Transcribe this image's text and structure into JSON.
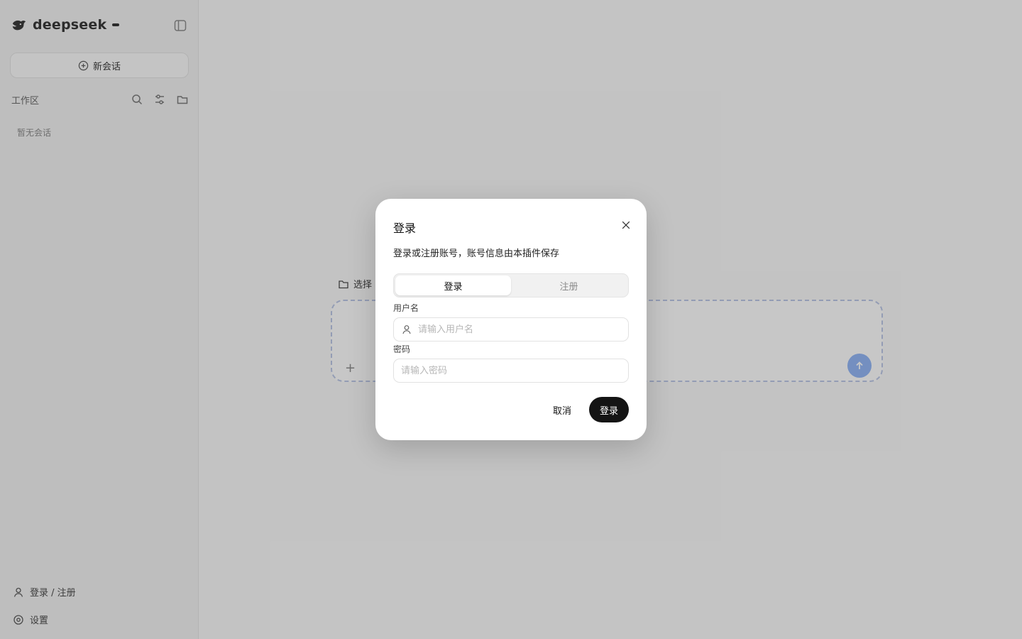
{
  "sidebar": {
    "brand_name": "deepseek",
    "brand_badge": "",
    "new_chat_label": "新会话",
    "workspace_label": "工作区",
    "empty_text": "暂无会话",
    "footer_login": "登录 / 注册",
    "footer_settings": "设置"
  },
  "main": {
    "hero_title": "",
    "hero_tag": "",
    "folder_label": "选择",
    "composer_placeholder": "",
    "plus_label": "+"
  },
  "modal": {
    "title": "登录",
    "description": "登录或注册账号，账号信息由本插件保存",
    "tabs": [
      {
        "label": "登录",
        "active": true
      },
      {
        "label": "注册",
        "active": false
      }
    ],
    "username_label": "用户名",
    "username_placeholder": "请输入用户名",
    "password_label": "密码",
    "password_placeholder": "请输入密码",
    "cancel_label": "取消",
    "submit_label": "登录"
  },
  "colors": {
    "overlay": "#282828",
    "primary_button": "#141414",
    "accent_blue": "#8fb4f6"
  },
  "icons": [
    "logo-icon",
    "sidebar-toggle-icon",
    "plus-circle-icon",
    "search-icon",
    "settings-sliders-icon",
    "folder-icon",
    "user-icon",
    "gear-icon",
    "close-icon",
    "send-arrow-icon"
  ]
}
